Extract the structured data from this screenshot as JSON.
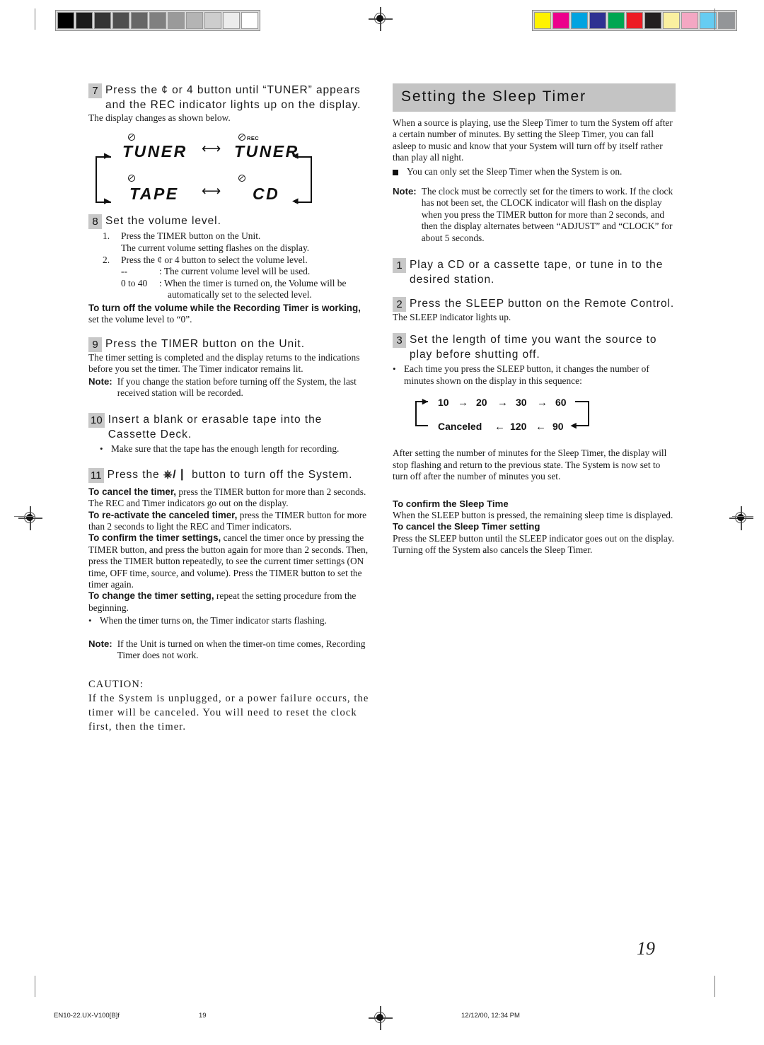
{
  "calibration": {
    "gray_swatches": [
      "#000000",
      "#1c1c1c",
      "#353535",
      "#4f4f4f",
      "#666666",
      "#808080",
      "#9a9a9a",
      "#b4b4b4",
      "#cdcdcd",
      "#ececec",
      "#ffffff"
    ],
    "color_swatches": [
      "#fff200",
      "#ec008c",
      "#00a3e0",
      "#2e3192",
      "#00a651",
      "#ed1c24",
      "#231f20",
      "#faf0a0",
      "#f4a7c3",
      "#66ccf2",
      "#939598"
    ]
  },
  "left_column": {
    "step7": {
      "number": "7",
      "headline": "Press the ¢   or 4   button until “TUNER” appears and the REC indicator lights up on the display.",
      "caption": "The display changes as shown below."
    },
    "lcd_figure": {
      "top_left_indicator": "clock-icon",
      "top_right_indicator": "clock-icon REC",
      "rec_label": "REC",
      "words": [
        "TUNER",
        "TUNER",
        "TAPE",
        "CD"
      ],
      "arrow": "⟷"
    },
    "step8": {
      "number": "8",
      "headline": "Set the volume level.",
      "items": [
        {
          "n": "1.",
          "text": "Press the TIMER button on the Unit.",
          "cont": "The current volume setting flashes on the display."
        },
        {
          "n": "2.",
          "text": "Press the ¢   or 4   button to select the volume level."
        }
      ],
      "definitions": [
        {
          "key": "--",
          "value": ": The current volume level will be used."
        },
        {
          "key": "0 to 40",
          "value": ": When the timer is turned on, the Volume will be"
        }
      ],
      "definition_cont": "automatically set to the selected level.",
      "bold_note_bold": "To turn off the volume while the Recording Timer is working,",
      "bold_note_rest": " set the volume level to “0”."
    },
    "step9": {
      "number": "9",
      "headline": "Press the TIMER button on the Unit.",
      "body": "The timer setting is completed and the display returns to the indications before you set the timer. The Timer indicator remains lit.",
      "note_label": "Note:",
      "note_text": "If you change the station before turning off the System, the last received station will  be recorded."
    },
    "step10": {
      "number": "10",
      "headline": "Insert a blank or erasable tape into the Cassette Deck.",
      "bullet": "Make sure that the tape has the enough length for recording."
    },
    "step11": {
      "number": "11",
      "headline_pre": "Press the ",
      "headline_icon": "power-icon",
      "headline_post": " button to turn off the System.",
      "paragraphs": [
        {
          "bold": "To cancel the timer,",
          "rest": " press the TIMER button for more than 2 seconds. The REC and Timer indicators go out on the display."
        },
        {
          "bold": "To re-activate the canceled timer,",
          "rest": " press the TIMER button for more than 2 seconds to light the REC and Timer indicators."
        },
        {
          "bold": "To confirm the timer settings,",
          "rest": " cancel the timer once by pressing the TIMER button, and press the button again for more than 2 seconds. Then, press the TIMER button repeatedly, to see the current timer settings (ON time, OFF time, source, and volume). Press the TIMER button to set the timer again."
        },
        {
          "bold": "To change the timer setting,",
          "rest": " repeat the setting procedure from the beginning."
        }
      ],
      "bullet": "When the timer turns on, the Timer indicator starts flashing.",
      "note_label": "Note:",
      "note_text": "If the Unit is turned on when the timer-on time comes, Recording Timer does not work."
    },
    "caution": {
      "label": "CAUTION:",
      "text": "If the System is unplugged, or a power failure occurs, the timer will be canceled. You will need to reset the clock first, then the timer."
    }
  },
  "right_column": {
    "section_title": "Setting the Sleep Timer",
    "intro": "When a source is playing, use the Sleep Timer to turn the System off after a certain number of minutes. By setting the Sleep Timer, you can fall asleep to music and know that your System will turn off by itself rather than play all night.",
    "square_bullet": "You can only set the Sleep Timer when the System is on.",
    "note_label": "Note:",
    "note_text": "The clock must be correctly set for the timers to work. If the clock has not been set, the CLOCK indicator will flash on the display when you press the TIMER button for more than 2 seconds, and then the display alternates between “ADJUST” and “CLOCK” for about 5 seconds.",
    "step1": {
      "number": "1",
      "headline": "Play a CD or a cassette tape, or tune in to the desired station."
    },
    "step2": {
      "number": "2",
      "headline": "Press the SLEEP button on the Remote Control.",
      "body": "The SLEEP indicator lights up."
    },
    "step3": {
      "number": "3",
      "headline": "Set the length of time you want the source to play before shutting off.",
      "bullet": "Each time you press the SLEEP button, it changes the number of minutes shown on the display in this sequence:"
    },
    "sequence_figure": {
      "top_row": [
        "10",
        "20",
        "30",
        "60"
      ],
      "bottom_row": [
        "Canceled",
        "120",
        "90"
      ],
      "forward_arrow": "→",
      "back_arrow": "←"
    },
    "after_text": "After setting the number of minutes for the Sleep Timer, the display will stop flashing and return to the previous state. The System is now set to turn off after the number of minutes you set.",
    "confirm_heading": "To confirm the Sleep Time",
    "confirm_body": "When the SLEEP button is pressed, the remaining sleep time is displayed.",
    "cancel_heading": "To cancel the Sleep Timer setting",
    "cancel_body": "Press the SLEEP button until the SLEEP indicator goes out on the display.",
    "cancel_body2": "Turning off the System also cancels the Sleep Timer."
  },
  "page_number": "19",
  "footer": {
    "file": "EN10-22.UX-V100[B]f",
    "page": "19",
    "date": "12/12/00, 12:34 PM"
  }
}
